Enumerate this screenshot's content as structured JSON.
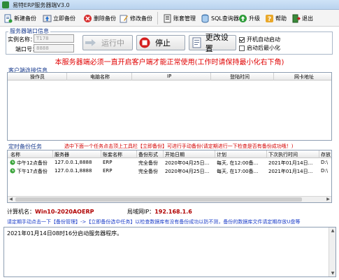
{
  "window": {
    "title": "易特ERP服务器端V3.0"
  },
  "toolbar": {
    "new_backup": "新建备份",
    "backup_now": "立即备份",
    "delete_backup": "删除备份",
    "edit_backup": "修改备份",
    "account_mgmt": "账套管理",
    "sql_analyzer": "SQL查询器",
    "upgrade": "升级",
    "help": "帮助",
    "exit": "退出"
  },
  "server_info": {
    "group_title": "服务器端口信息",
    "instance_label": "实例名称：",
    "instance_value": "T178",
    "port_label": "端口号：",
    "port_value": "8888",
    "run_button": "运行中",
    "stop_button": "停止",
    "settings_button": "更改设置",
    "autostart_label": "开机自动启动",
    "autostart_checked": true,
    "minimize_label": "启动后最小化",
    "minimize_checked": false
  },
  "banner": "本服务器端必须一直开启客户端才能正常使用(工作时请保持最小化右下角)",
  "clients": {
    "group_title": "客户端连接信息",
    "columns": [
      "操作员",
      "电脑名称",
      "IP",
      "登陆时间",
      "网卡地址"
    ]
  },
  "schedule": {
    "group_title": "定时备份任务",
    "hint": "选中下面一个任务点击顶上工具栏【立即备份】可进行手动备份(请定期进行一下检查是否有备份成功哦！)",
    "columns": [
      "名称",
      "服务器",
      "账套名称",
      "备份形式",
      "开始日期",
      "计划",
      "下次执行时间",
      "存放"
    ],
    "rows": [
      [
        "中午12点备份",
        "127.0.0.1,8888",
        "ERP",
        "完全备份",
        "2020年04月25日...",
        "每天, 在12:00备...",
        "2021年01月14日...",
        "D:\\"
      ],
      [
        "下午17点备份",
        "127.0.0.1,8888",
        "ERP",
        "完全备份",
        "2020年04月25日...",
        "每天, 在17:00备...",
        "2021年01月14日...",
        "D:\\"
      ]
    ]
  },
  "footer": {
    "computer_label": "计算机名：",
    "computer_value": "Win10-2020AOERP",
    "lan_label": "局域网IP：",
    "lan_value": "192.168.1.6",
    "notice": "请定期手动点击一下【备份管理】->【立即备份选中任务】以检查数据库有没有备份成功以防不测，备份的数据库文件请定期存放U盘等"
  },
  "log": {
    "text": "2021年01月14日08时16分启动服务器程序。"
  }
}
